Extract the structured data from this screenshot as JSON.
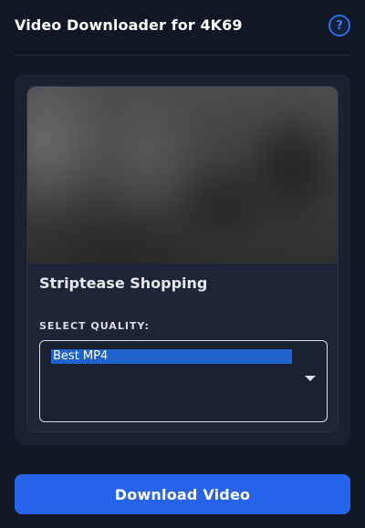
{
  "header": {
    "title": "Video Downloader for 4K69",
    "help_label": "?"
  },
  "video": {
    "title": "Striptease Shopping"
  },
  "quality": {
    "label": "SELECT QUALITY:",
    "selected_option": "Best MP4"
  },
  "actions": {
    "download_label": "Download Video"
  },
  "colors": {
    "background": "#111724",
    "accent": "#2563eb",
    "selected_option": "#1f62cc"
  },
  "icons": {
    "help": "help-icon",
    "dropdown": "chevron-down-icon"
  }
}
